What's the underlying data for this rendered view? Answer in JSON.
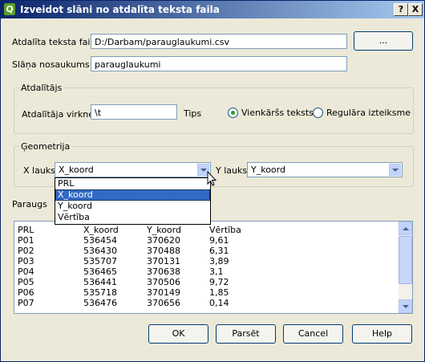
{
  "window": {
    "title": "Izveidot slāni no atdalīta teksta faila",
    "help_btn": "?",
    "close_btn": "X"
  },
  "file": {
    "label": "Atdalīta teksta fails",
    "value": "D:/Darbam/parauglaukumi.csv",
    "browse_label": "..."
  },
  "layer": {
    "label": "Slāņa nosaukums",
    "value": "parauglaukumi"
  },
  "delimiter": {
    "group_title": "Atdalītājs",
    "label": "Atdalītāja virkne",
    "value": "\\t",
    "type_label": "Tips",
    "options": [
      {
        "label": "Vienkāršs teksts",
        "checked": true
      },
      {
        "label": "Regulāra izteiksme",
        "checked": false
      }
    ]
  },
  "geometry": {
    "group_title": "Ģeometrija",
    "x_label": "X lauks",
    "x_value": "X_koord",
    "y_label": "Y lauks",
    "y_value": "Y_koord",
    "dropdown_options": [
      "PRL",
      "X_koord",
      "Y_koord",
      "Vērtība"
    ],
    "dropdown_selected": 1
  },
  "preview": {
    "label": "Paraugs",
    "headers": [
      "PRL",
      "X_koord",
      "Y_koord",
      "Vērtība"
    ],
    "rows": [
      [
        "P01",
        "536454",
        "370620",
        "9,61"
      ],
      [
        "P02",
        "536430",
        "370488",
        "6,31"
      ],
      [
        "P03",
        "535707",
        "370131",
        "3,89"
      ],
      [
        "P04",
        "536465",
        "370638",
        "3,1"
      ],
      [
        "P05",
        "536441",
        "370506",
        "9,72"
      ],
      [
        "P06",
        "535718",
        "370149",
        "1,85"
      ],
      [
        "P07",
        "536476",
        "370656",
        "0,14"
      ]
    ]
  },
  "buttons": {
    "ok": "OK",
    "parse": "Parsēt",
    "cancel": "Cancel",
    "help": "Help"
  }
}
